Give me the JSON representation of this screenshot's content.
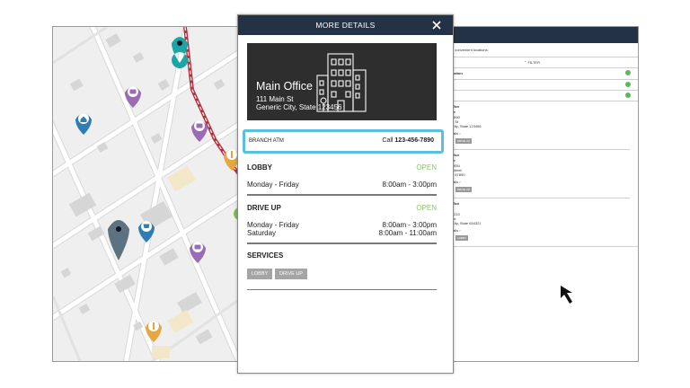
{
  "modal": {
    "title": "MORE DETAILS",
    "close_icon": "close-icon",
    "hero": {
      "name": "Main Office",
      "street": "111 Main St",
      "city": "Generic City, State 123456",
      "icon": "building-icon"
    },
    "atm": {
      "label": "BRANCH ATM",
      "call_prefix": "Call",
      "phone": "123-456-7890"
    },
    "lobby": {
      "title": "LOBBY",
      "status": "OPEN",
      "rows": [
        {
          "days": "Monday - Friday",
          "hours": "8:00am - 3:00pm"
        }
      ]
    },
    "drive_up": {
      "title": "DRIVE UP",
      "status": "OPEN",
      "rows": [
        {
          "days": "Monday - Friday",
          "hours": "8:00am - 3:00pm"
        },
        {
          "days": "Saturday",
          "hours": "8:00am - 11:00am"
        }
      ]
    },
    "services": {
      "title": "SERVICES",
      "buttons": [
        "LOBBY",
        "DRIVE UP"
      ]
    }
  },
  "list_panel": {
    "intro": "e convenient locations:",
    "filter_label": "FILTER",
    "location_header": "cation",
    "entries": [
      {
        "title": "ffice",
        "lines": [
          "ile",
          "7890",
          "1 St",
          "City, State 123456",
          "tails ›"
        ],
        "btn": "DRIVE UP"
      },
      {
        "title": "ffice",
        "lines": [
          "ile",
          "7654",
          "Street",
          "e 67890",
          "tails ›"
        ],
        "btn": "DRIVE UP"
      },
      {
        "title": "ffice",
        "lines": [
          "3210",
          "ue",
          "City, State 654321",
          "tails ›"
        ],
        "btn": "LOBBY"
      }
    ]
  },
  "map": {
    "pins": [
      "location-pin-teal",
      "atm-pin-purple",
      "home-pin-blue",
      "atm-pin-purple",
      "restaurant-pin-orange",
      "current-location-pin",
      "shopping-pin-blue",
      "atm-pin-purple",
      "restaurant-pin-orange"
    ]
  },
  "colors": {
    "header_navy": "#243245",
    "open_green": "#8cc66a",
    "highlight_blue": "#5bc0de",
    "pin_teal": "#1aa6a6",
    "pin_purple": "#9a6cb5",
    "pin_blue": "#2f7db3",
    "pin_orange": "#e6a640",
    "pin_gray": "#5c7280"
  }
}
